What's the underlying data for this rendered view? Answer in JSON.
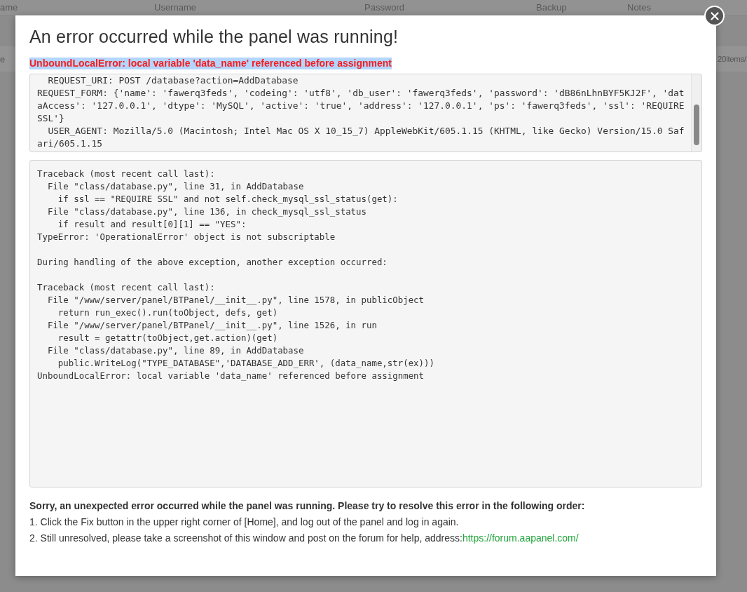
{
  "background": {
    "columns": [
      "ame",
      "Username",
      "Password",
      "Backup",
      "Notes"
    ],
    "toolbar_left": "e",
    "pagination": "20items/"
  },
  "dialog": {
    "title": "An error occurred while the panel was running!",
    "error_message": "UnboundLocalError: local variable 'data_name' referenced before assignment",
    "request_lines": [
      "  REQUEST_URI: POST /database?action=AddDatabase",
      "REQUEST_FORM: {'name': 'fawerq3feds', 'codeing': 'utf8', 'db_user': 'fawerq3feds', 'password': 'dB86nLhnBYF5KJ2F', 'dataAccess': '127.0.0.1', 'dtype': 'MySQL', 'active': 'true', 'address': '127.0.0.1', 'ps': 'fawerq3feds', 'ssl': 'REQUIRE SSL'}",
      "  USER_AGENT: Mozilla/5.0 (Macintosh; Intel Mac OS X 10_15_7) AppleWebKit/605.1.15 (KHTML, like Gecko) Version/15.0 Safari/605.1.15"
    ],
    "traceback_blocks": [
      [
        "Traceback (most recent call last):",
        "  File \"class/database.py\", line 31, in AddDatabase",
        "    if ssl == \"REQUIRE SSL\" and not self.check_mysql_ssl_status(get):",
        "  File \"class/database.py\", line 136, in check_mysql_ssl_status",
        "    if result and result[0][1] == \"YES\":",
        "TypeError: 'OperationalError' object is not subscriptable"
      ],
      [
        "During handling of the above exception, another exception occurred:"
      ],
      [
        "Traceback (most recent call last):",
        "  File \"/www/server/panel/BTPanel/__init__.py\", line 1578, in publicObject",
        "    return run_exec().run(toObject, defs, get)",
        "  File \"/www/server/panel/BTPanel/__init__.py\", line 1526, in run",
        "    result = getattr(toObject,get.action)(get)",
        "  File \"class/database.py\", line 89, in AddDatabase",
        "    public.WriteLog(\"TYPE_DATABASE\",'DATABASE_ADD_ERR', (data_name,str(ex)))",
        "UnboundLocalError: local variable 'data_name' referenced before assignment"
      ]
    ],
    "help": {
      "intro": "Sorry, an unexpected error occurred while the panel was running. Please try to resolve this error in the following order:",
      "steps": [
        {
          "text": "1. Click the Fix button in the upper right corner of [Home], and log out of the panel and log in again."
        },
        {
          "text": "2. Still unresolved, please take a screenshot of this window and post on the forum for help, address:",
          "link": "https://forum.aapanel.com/"
        }
      ]
    }
  }
}
